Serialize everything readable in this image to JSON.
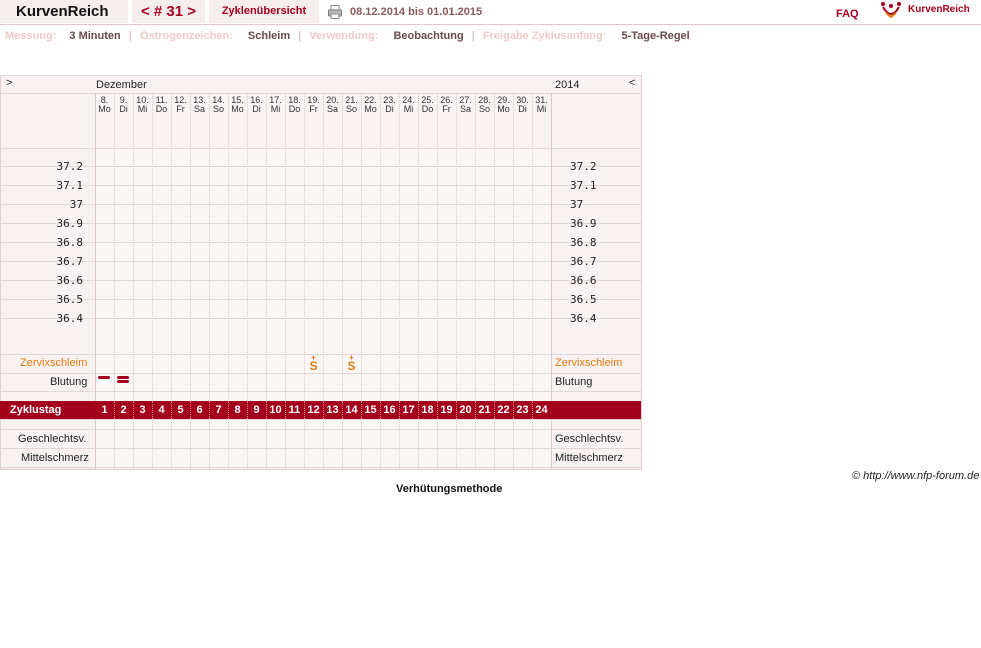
{
  "app": {
    "title": "KurvenReich",
    "cycle_number": "< # 31 >",
    "overview_tab": "Zyklenübersicht",
    "date_range": "08.12.2014 bis 01.01.2015",
    "faq": "FAQ",
    "logo_text": "KurvenReich"
  },
  "settings": [
    {
      "label": "Messung:",
      "value": "3 Minuten"
    },
    {
      "label": "Östrogenzeichen:",
      "value": "Schleim"
    },
    {
      "label": "Verwendung:",
      "value": "Beobachtung"
    },
    {
      "label": "Freigabe Zyklusanfang:",
      "value": "5-Tage-Regel"
    }
  ],
  "chart": {
    "nav_prev": ">",
    "nav_next": "<",
    "month": "Dezember",
    "year": "2014",
    "days": [
      {
        "date": "8.",
        "wd": "Mo",
        "weekend": false
      },
      {
        "date": "9.",
        "wd": "Di",
        "weekend": false
      },
      {
        "date": "10.",
        "wd": "Mi",
        "weekend": false
      },
      {
        "date": "11.",
        "wd": "Do",
        "weekend": false
      },
      {
        "date": "12.",
        "wd": "Fr",
        "weekend": false
      },
      {
        "date": "13.",
        "wd": "Sa",
        "weekend": true
      },
      {
        "date": "14.",
        "wd": "So",
        "weekend": true
      },
      {
        "date": "15.",
        "wd": "Mo",
        "weekend": false
      },
      {
        "date": "16.",
        "wd": "Di",
        "weekend": false
      },
      {
        "date": "17.",
        "wd": "Mi",
        "weekend": false
      },
      {
        "date": "18.",
        "wd": "Do",
        "weekend": false
      },
      {
        "date": "19.",
        "wd": "Fr",
        "weekend": false
      },
      {
        "date": "20.",
        "wd": "Sa",
        "weekend": true
      },
      {
        "date": "21.",
        "wd": "So",
        "weekend": true
      },
      {
        "date": "22.",
        "wd": "Mo",
        "weekend": false
      },
      {
        "date": "23.",
        "wd": "Di",
        "weekend": false
      },
      {
        "date": "24.",
        "wd": "Mi",
        "weekend": false
      },
      {
        "date": "25.",
        "wd": "Do",
        "weekend": false
      },
      {
        "date": "26.",
        "wd": "Fr",
        "weekend": false
      },
      {
        "date": "27.",
        "wd": "Sa",
        "weekend": true
      },
      {
        "date": "28.",
        "wd": "So",
        "weekend": true
      },
      {
        "date": "29.",
        "wd": "Mo",
        "weekend": false
      },
      {
        "date": "30.",
        "wd": "Di",
        "weekend": false
      },
      {
        "date": "31.",
        "wd": "Mi",
        "weekend": false
      }
    ],
    "temperatures": [
      "37.2",
      "37.1",
      "37",
      "36.9",
      "36.8",
      "36.7",
      "36.6",
      "36.5",
      "36.4"
    ],
    "rows": {
      "cervix": "Zervixschleim",
      "bleeding": "Blutung",
      "cycle_day": "Zyklustag",
      "intercourse": "Geschlechtsv.",
      "mittelschmerz": "Mittelschmerz"
    },
    "cycle_days": [
      "1",
      "2",
      "3",
      "4",
      "5",
      "6",
      "7",
      "8",
      "9",
      "10",
      "11",
      "12",
      "13",
      "14",
      "15",
      "16",
      "17",
      "18",
      "19",
      "20",
      "21",
      "22",
      "23",
      "24"
    ],
    "cervix_symbol": "S̈",
    "cervix_marks": [
      {
        "day_index": 11,
        "symbol": "S",
        "accent": "+"
      },
      {
        "day_index": 13,
        "symbol": "S",
        "accent": "+"
      }
    ],
    "bleeding_marks": [
      {
        "day_index": 0,
        "intensity": "light"
      },
      {
        "day_index": 1,
        "intensity": "medium"
      }
    ],
    "colors": {
      "accent": "#a4001d",
      "cervix": "#e07a10",
      "panel": "#f8f2f2",
      "weekend": "#f1dfdf"
    }
  },
  "footer": {
    "copyright": "© http://www.nfp-forum.de",
    "method": "Verhütungsmethode"
  }
}
